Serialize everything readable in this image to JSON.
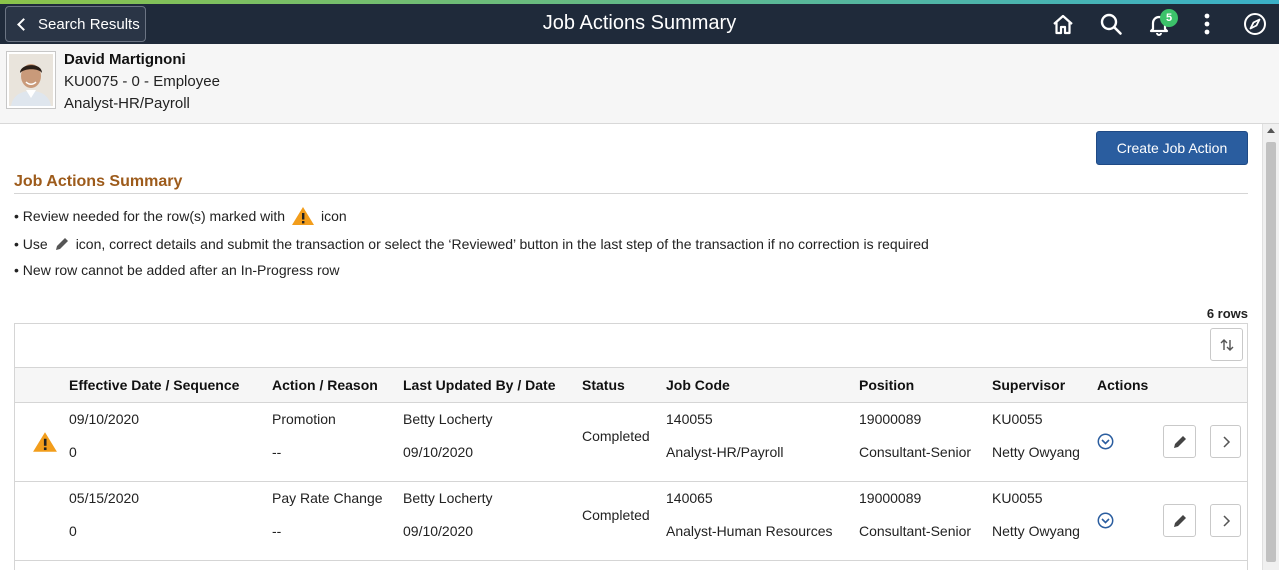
{
  "colors": {
    "header_bg": "#1f2a3a",
    "brand_accent": "#8bc34a",
    "section_title": "#9d5b1b",
    "primary_button": "#2a5d9f",
    "badge": "#3cc26a",
    "warning": "#f29d1b"
  },
  "header": {
    "back_label": "Search Results",
    "title": "Job Actions Summary",
    "notification_count": "5",
    "icons": [
      "home-icon",
      "search-icon",
      "bell-icon",
      "more-vertical-icon",
      "navigator-compass-icon"
    ]
  },
  "person": {
    "name": "David Martignoni",
    "id_line": "KU0075 - 0 - Employee",
    "job_title": "Analyst-HR/Payroll"
  },
  "create_button_label": "Create Job Action",
  "section_title": "Job Actions Summary",
  "notes": {
    "n1_pre": "• Review needed for the row(s) marked with",
    "n1_post": "icon",
    "n2_pre": "• Use",
    "n2_post": "icon, correct details and submit the transaction or select the ‘Reviewed’ button in the last step of the transaction if no correction is required",
    "n3": "• New row cannot be added after an In-Progress row"
  },
  "rows_count": "6 rows",
  "columns": {
    "effective": "Effective Date / Sequence",
    "action": "Action / Reason",
    "updated": "Last Updated By / Date",
    "status": "Status",
    "jobcode": "Job Code",
    "position": "Position",
    "supervisor": "Supervisor",
    "actions": "Actions"
  },
  "rows": [
    {
      "warning": true,
      "eff_date": "09/10/2020",
      "seq": "0",
      "action": "Promotion",
      "reason": "--",
      "updated_by": "Betty Locherty",
      "updated_date": "09/10/2020",
      "status": "Completed",
      "job_code": "140055",
      "job_desc": "Analyst-HR/Payroll",
      "position": "19000089",
      "position_desc": "Consultant-Senior",
      "supervisor_id": "KU0055",
      "supervisor_name": "Netty Owyang"
    },
    {
      "warning": false,
      "eff_date": "05/15/2020",
      "seq": "0",
      "action": "Pay Rate Change",
      "reason": "--",
      "updated_by": "Betty Locherty",
      "updated_date": "09/10/2020",
      "status": "Completed",
      "job_code": "140065",
      "job_desc": "Analyst-Human Resources",
      "position": "19000089",
      "position_desc": "Consultant-Senior",
      "supervisor_id": "KU0055",
      "supervisor_name": "Netty Owyang"
    }
  ]
}
